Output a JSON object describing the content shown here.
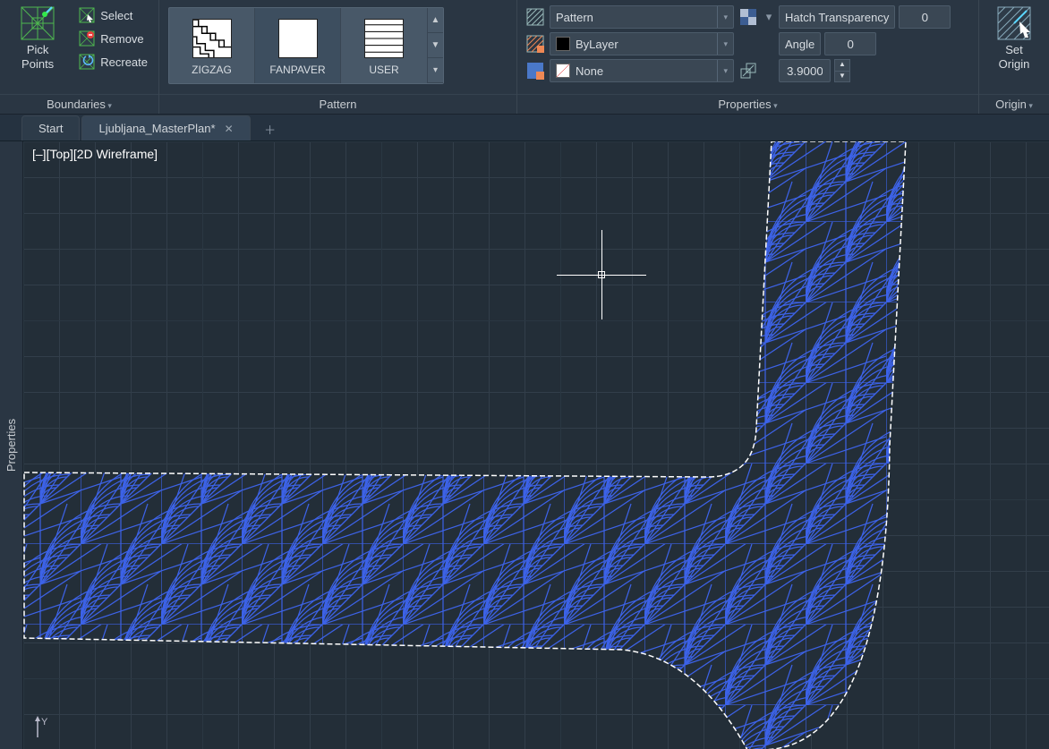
{
  "panels": {
    "boundaries": {
      "title": "Boundaries",
      "pick_points": "Pick Points",
      "select": "Select",
      "remove": "Remove",
      "recreate": "Recreate"
    },
    "pattern": {
      "title": "Pattern",
      "items": [
        "ZIGZAG",
        "FANPAVER",
        "USER"
      ]
    },
    "properties": {
      "title": "Properties",
      "type_value": "Pattern",
      "color_value": "ByLayer",
      "bg_value": "None",
      "transparency_label": "Hatch Transparency",
      "transparency_value": "0",
      "angle_label": "Angle",
      "angle_value": "0",
      "scale_value": "3.9000"
    },
    "origin": {
      "title": "Origin",
      "set_origin_l1": "Set",
      "set_origin_l2": "Origin"
    }
  },
  "tabs": {
    "start": "Start",
    "file": "Ljubljana_MasterPlan*"
  },
  "view": {
    "label": "[–][Top][2D Wireframe]",
    "sidebar": "Properties"
  },
  "icons": {
    "pick_points": "pick-points-icon",
    "select": "select-icon",
    "remove": "remove-icon",
    "recreate": "recreate-icon",
    "hatch_type": "hatch-type-icon",
    "hatch_color": "hatch-color-icon",
    "hatch_bg": "hatch-bg-icon",
    "transparency": "transparency-icon",
    "angle": "angle-icon",
    "scale": "scale-icon",
    "set_origin": "set-origin-icon",
    "y_axis": "Y"
  },
  "colors": {
    "hatch_blue": "#3c62e8",
    "boundary": "#ffffff"
  }
}
